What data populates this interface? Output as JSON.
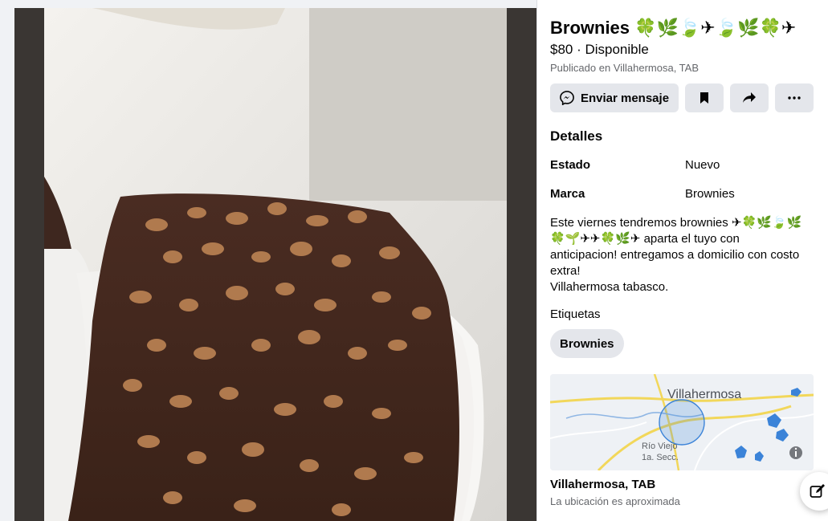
{
  "listing": {
    "title": "Brownies 🍀🌿🍃✈🍃🌿🍀✈",
    "price_status": "$80 · Disponible",
    "location": "Publicado en Villahermosa, TAB"
  },
  "actions": {
    "message_label": "Enviar mensaje",
    "icons": [
      "messenger-icon",
      "bookmark-icon",
      "share-icon",
      "more-icon"
    ]
  },
  "details": {
    "heading": "Detalles",
    "rows": [
      {
        "key": "Estado",
        "value": "Nuevo"
      },
      {
        "key": "Marca",
        "value": "Brownies"
      }
    ],
    "description": "Este viernes tendremos brownies ✈🍀🌿🍃🌿\n🍀🌱✈✈🍀🌿✈ aparta el tuyo con\nanticipacion! entregamos a domicilio con costo\nextra!\nVillahermosa tabasco."
  },
  "tags": {
    "heading": "Etiquetas",
    "items": [
      "Brownies"
    ]
  },
  "map": {
    "city_label": "Villahermosa",
    "area_label": "Río Viejo\n1a. Secc.",
    "location": "Villahermosa, TAB",
    "note": "La ubicación es aproximada"
  },
  "colors": {
    "page_bg": "#f0f2f5",
    "button_bg": "#e4e6eb",
    "muted_text": "#65676b",
    "map_road": "#f2d75a",
    "map_water": "#3b83d8"
  }
}
